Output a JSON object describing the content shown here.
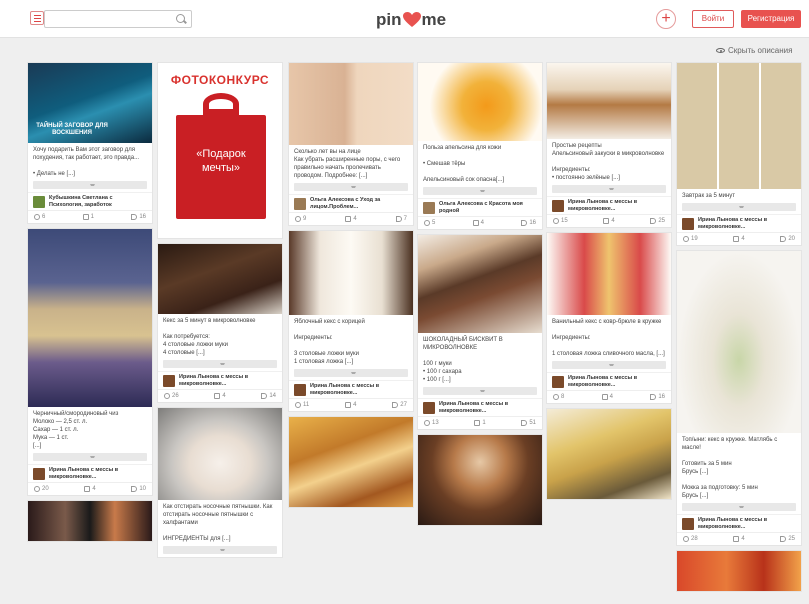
{
  "header": {
    "search_placeholder": "",
    "logo_left": "pin",
    "logo_right": "me",
    "login": "Войти",
    "register": "Регистрация",
    "hide_descriptions": "Скрыть описания"
  },
  "colors": {
    "accent": "#e8524f",
    "brand": "#d44"
  },
  "columns": [
    [
      {
        "h": 80,
        "bg": "linear-gradient(160deg,#1a3a55,#0f5d7d 45%,#2b8fb0 60%,#0b2a3e)",
        "overlay": "ТАЙНЫЙ ЗАГОВОР ДЛЯ ВОСКШЕНИЯ",
        "desc": "Хочу подарить Вам этот заговор для похудения, так работает, это правда...\n\n• Делать не [...]",
        "author": "Кубышкина Светлана с Психология, заработок",
        "av": "#6a8c3a",
        "s": [
          "6",
          "1",
          "16"
        ]
      },
      {
        "h": 178,
        "bg": "linear-gradient(180deg,#3d4a78 0%,#5a6390 30%,#c9b28a 45%,#d8c290 60%,#6b5b8b 75%,#2d2b55 100%)",
        "desc": "Черничный/смородиновый чиз\nМолоко — 2,5 ст. л.\nСахар — 1 ст. л.\nМука — 1 ст.\n[...]",
        "author": "Ирина Лынова с мессы в микроволновке...",
        "av": "#7b4a2a",
        "s": [
          "20",
          "4",
          "10"
        ]
      },
      {
        "h": 40,
        "bg": "linear-gradient(90deg,#2a1a1a,#7a5a4a 30%,#1a1a1a 50%,#c87a4a 70%,#2a1a1a)",
        "desc": "",
        "author": "",
        "av": "",
        "s": []
      }
    ],
    [
      {
        "h": 175,
        "bg": "#fff",
        "overlay": "ФОТОКОНКУРС",
        "gift": "«Подарок мечты»",
        "desc": "",
        "author": "",
        "av": "",
        "s": []
      },
      {
        "h": 70,
        "bg": "linear-gradient(160deg,#2a1a12,#5a3a26 40%,#3a2218 70%,#d9d2c8)",
        "desc": "Кекс за 5 минут в микроволновке\n\nКак потребуется:\n4 столовые ложки муки\n4 столовые [...]",
        "author": "Ирина Лынова с мессы в микроволновке...",
        "av": "#7b4a2a",
        "s": [
          "26",
          "4",
          "14"
        ]
      },
      {
        "h": 92,
        "bg": "radial-gradient(ellipse at 50% 60%,#f6f0ea 0%,#e8ddd2 35%,#c9c6c2 55%,#7d7c7a 100%)",
        "desc": "Как отстирать носочные пятнышки. Как отстирать носочные пятнышки с халфантами\n\nИНГРЕДИЕНТЫ для [...]",
        "author": "",
        "av": "",
        "s": []
      }
    ],
    [
      {
        "h": 82,
        "bg": "linear-gradient(90deg,#e7c6a9,#d9b294 45%,#efd6bd 55%,#f2dcc6)",
        "desc": "Сколько лет вы на лице\nКак убрать расширенные поры, с чего правильно начать пролечивать проводом. Подробнее: [...]",
        "author": "Ольга Алексова с Уход за лицом.Проблем...",
        "av": "#9a7a55",
        "s": [
          "9",
          "4",
          "7"
        ]
      },
      {
        "h": 84,
        "bg": "linear-gradient(90deg,#5a3a2a,#efe7dc 25%,#fdfaf4 50%,#e9e0d2 75%,#4a3020)",
        "desc": "Яблочный кекс с корицей\n\nИнгредиенты:\n\n3 столовые ложки муки\n1 столовая ложка [...]",
        "author": "Ирина Лынова с мессы в микроволновке...",
        "av": "#7b4a2a",
        "s": [
          "11",
          "4",
          "27"
        ]
      },
      {
        "h": 90,
        "bg": "linear-gradient(160deg,#e9b14a,#c27a2a 35%,#f3d08c 55%,#a35820 80%,#e2a24a)",
        "desc": "",
        "author": "",
        "av": "",
        "s": []
      }
    ],
    [
      {
        "h": 78,
        "bg": "radial-gradient(circle at 55% 55%,#f39a1a 0%,#f2b23a 30%,#fffaf2 70%)",
        "desc": "Польза апельсина для кожи\n\n• Смешав тёры\n\nАпельсиновый сок опасна[...]",
        "author": "Ольга Алексова с Красота моя родной",
        "av": "#9a7a55",
        "s": [
          "5",
          "4",
          "16"
        ]
      },
      {
        "h": 98,
        "bg": "linear-gradient(160deg,#f3ece4,#c9a98a 25%,#5a3a28 45%,#7a4a32 60%,#e7ddd0)",
        "desc": "ШОКОЛАДНЫЙ БИСКВИТ В МИКРОВОЛНОВКЕ\n\n100 г муки\n• 100 г сахара\n• 100 г [...]",
        "author": "Ирина Лынова с мессы в микроволновке...",
        "av": "#7b4a2a",
        "s": [
          "13",
          "1",
          "51"
        ]
      },
      {
        "h": 90,
        "bg": "radial-gradient(ellipse at 50% 30%,#e6c8a6 0%,#b77a4a 30%,#6a3e24 55%,#2a1a14 100%)",
        "desc": "",
        "author": "",
        "av": "",
        "s": []
      }
    ],
    [
      {
        "h": 76,
        "bg": "linear-gradient(180deg,#fbf6ee,#e5d2b8 35%,#b47a44 55%,#f3ede4)",
        "desc": "Простые рецепты\nАпельсиновый закуски в микроволновке\n\nИнгредиенты:\n• постоянно зелёные [...]",
        "author": "Ирина Лынова с мессы в микроволновке...",
        "av": "#7b4a2a",
        "s": [
          "15",
          "4",
          "25"
        ]
      },
      {
        "h": 82,
        "bg": "linear-gradient(90deg,#fdfaf6,#d94a4a 30%,#efc46e 50%,#d94a4a 75%,#fdfaf6)",
        "desc": "Ванильный кекс с ковр-брюле в кружке\n\nИнгредиенты:\n\n1 столовая ложка сливочного масла, [...]",
        "author": "Ирина Лынова с мессы в микроволновке...",
        "av": "#7b4a2a",
        "s": [
          "8",
          "4",
          "16"
        ]
      },
      {
        "h": 90,
        "bg": "linear-gradient(160deg,#f4ecd8,#e2c46a 35%,#c9a24a 55%,#6a5a3a 80%,#f0e4c8)",
        "desc": "",
        "author": "",
        "av": "",
        "s": []
      }
    ],
    [
      {
        "h": 126,
        "bg": "repeating-linear-gradient(90deg,#d9c9a6 0 40px,#fff 40px 42px),linear-gradient(180deg,#e8b54a,#d9c49a)",
        "desc": "Завтрак за 5 минут",
        "author": "Ирина Лынова с мессы в микроволновке...",
        "av": "#7b4a2a",
        "s": [
          "19",
          "4",
          "20"
        ]
      },
      {
        "h": 182,
        "bg": "radial-gradient(ellipse at 50% 60%,#c8d6a8 0%,#e9e4d6 30%,#f6f4f0 70%)",
        "desc": "Топ/ыни: кекс в кружке. Матлябь с масле!\n\nГотовить за 5 мин\nБрусь [...]\n\nМокка за подготовку: 5 мин\nБрусь [...]",
        "author": "Ирина Лынова с мессы в микроволновке...",
        "av": "#7b4a2a",
        "s": [
          "28",
          "4",
          "25"
        ]
      },
      {
        "h": 40,
        "bg": "linear-gradient(90deg,#d9482a,#e87a3a 40%,#b8321a 70%,#f2a24a)",
        "desc": "",
        "author": "",
        "av": "",
        "s": []
      }
    ]
  ]
}
